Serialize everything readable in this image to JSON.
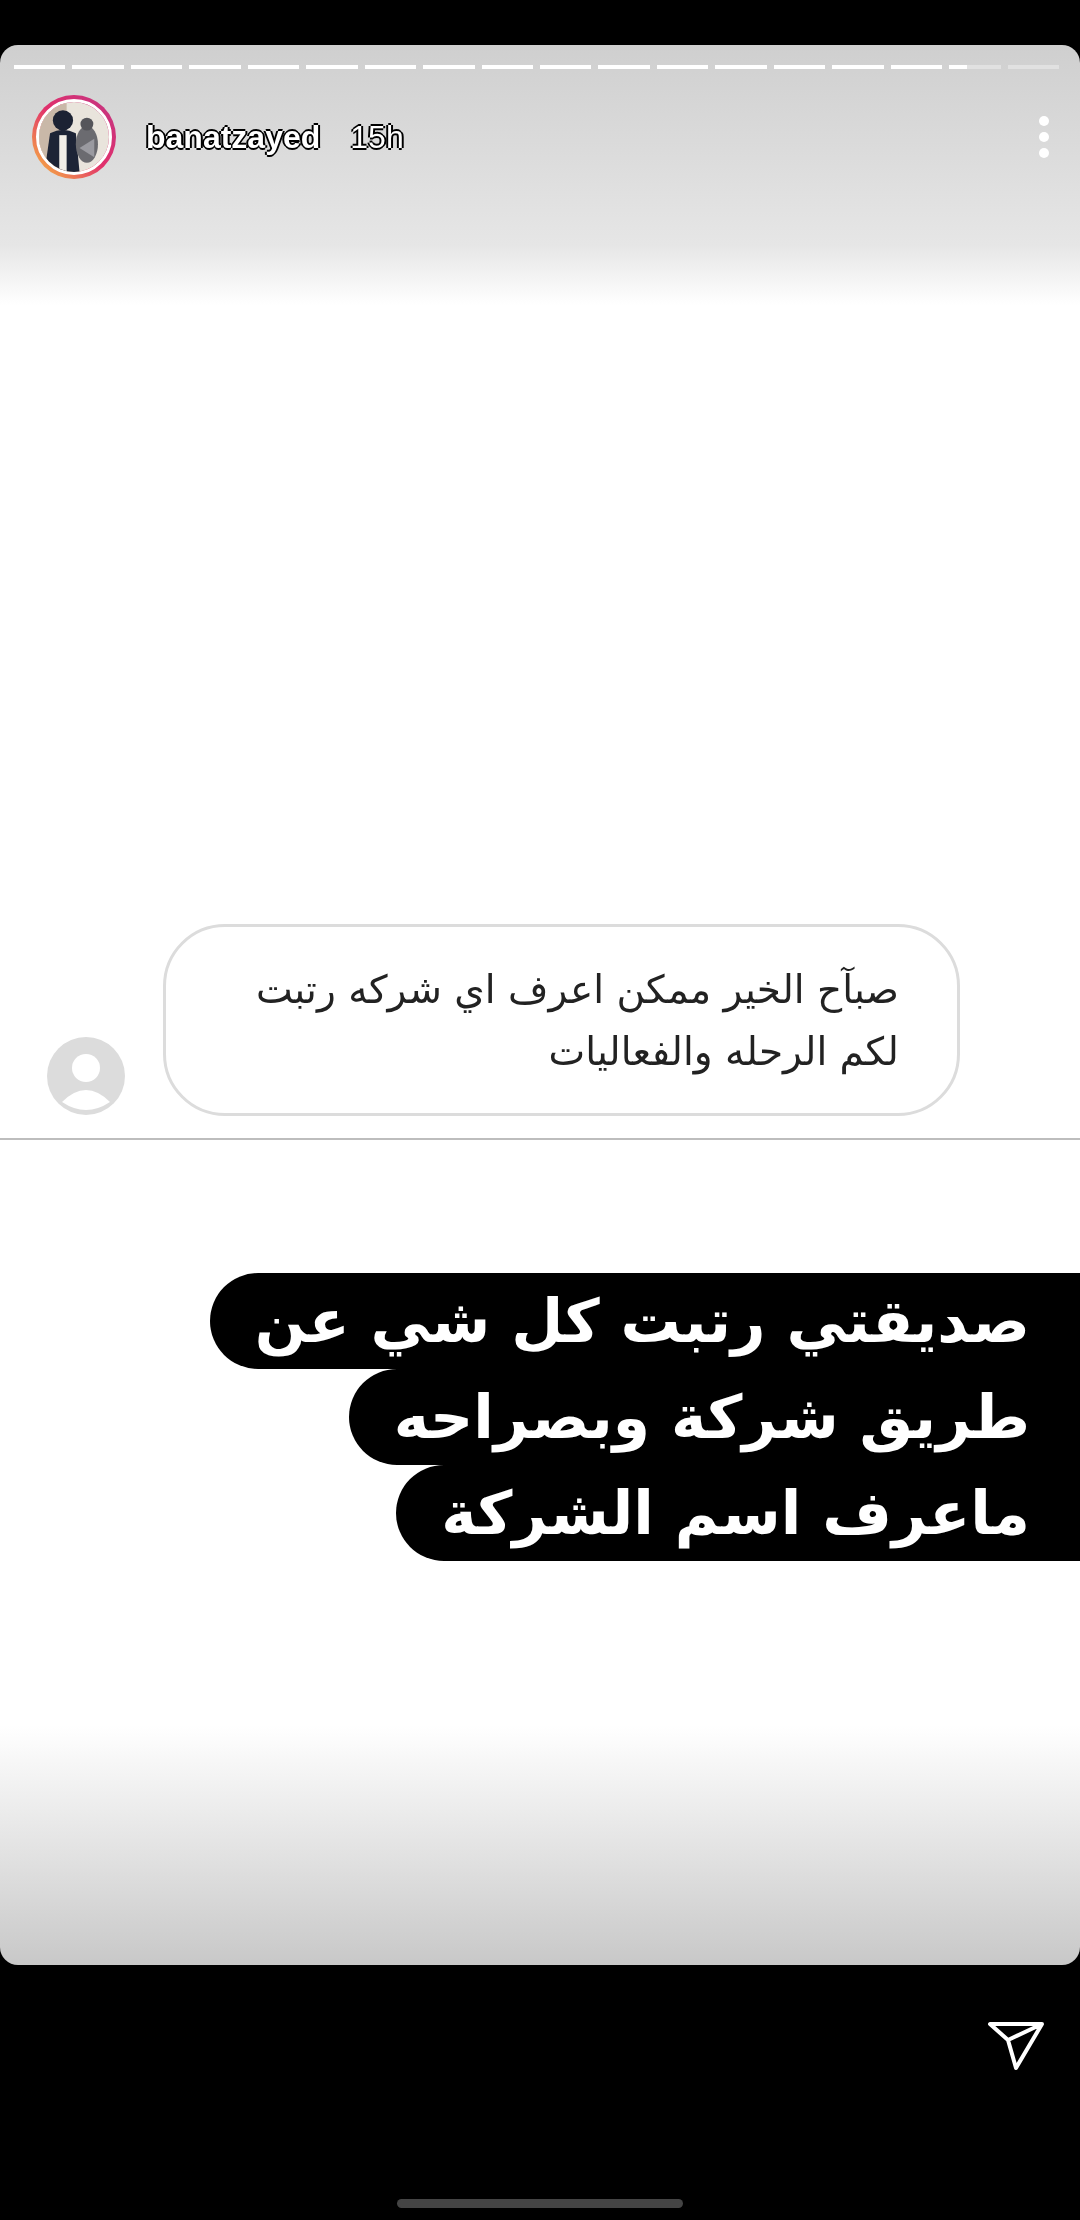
{
  "story": {
    "progress": {
      "level": 0.906
    },
    "author": {
      "username": "banatzayed",
      "time": "15h"
    },
    "question": {
      "text": "صبآح الخير ممكن اعرف اي شركه رتبت لكم الرحله والفعاليات"
    },
    "answer_lines": [
      "صديقتي رتبت كل شي عن",
      "طريق شركة وبصراحه",
      "ماعرف اسم الشركة"
    ]
  }
}
